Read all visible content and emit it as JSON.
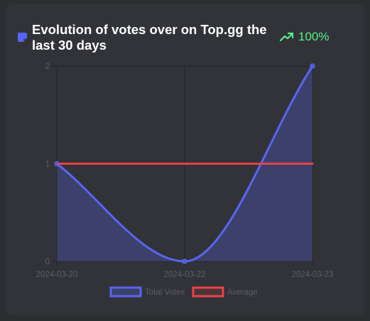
{
  "header": {
    "title": "Evolution of votes over on Top.gg the last 30 days",
    "trend_value": "100%",
    "title_icon": "sticky-note-icon",
    "trend_icon": "trending-up-icon"
  },
  "colors": {
    "card_background": "#313338",
    "title_icon": "#5865f2",
    "trend": "#57f287",
    "total_votes": "#5865f2",
    "total_votes_fill": "rgba(88,101,242,0.28)",
    "average": "#ed4245",
    "grid": "#202225",
    "text_muted": "#5c5f66"
  },
  "chart_data": {
    "type": "line",
    "title": "Evolution of votes over on Top.gg the last 30 days",
    "xlabel": "",
    "ylabel": "",
    "categories": [
      "2024-03-20",
      "2024-03-22",
      "2024-03-23"
    ],
    "ylim": [
      0,
      2
    ],
    "yticks": [
      "0",
      "1",
      "2"
    ],
    "grid": true,
    "legend_position": "bottom",
    "series": [
      {
        "name": "Total Votes",
        "values": [
          1,
          0,
          2
        ],
        "fill": true,
        "smooth": true
      },
      {
        "name": "Average",
        "values": [
          1,
          1,
          1
        ],
        "fill": false,
        "smooth": false
      }
    ]
  }
}
